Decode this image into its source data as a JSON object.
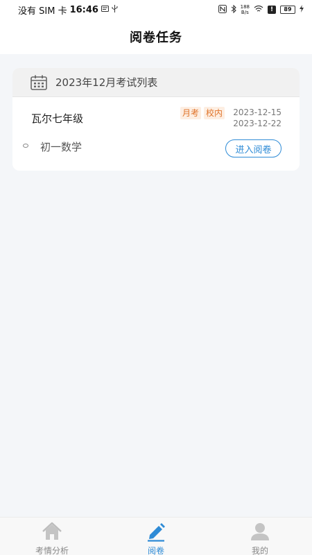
{
  "status_bar": {
    "carrier": "没有 SIM 卡",
    "time": "16:46",
    "net_speed_top": "188",
    "net_speed_bottom": "B/s",
    "alert": "!",
    "battery": "89"
  },
  "header": {
    "title": "阅卷任务"
  },
  "exam_list": {
    "heading": "2023年12月考试列表",
    "exams": [
      {
        "name": "瓦尔七年级",
        "tags": [
          "月考",
          "校内"
        ],
        "start_date": "2023-12-15",
        "end_date": "2023-12-22",
        "subjects": [
          {
            "name": "初一数学",
            "action_label": "进入阅卷"
          }
        ]
      }
    ]
  },
  "tabbar": {
    "tabs": [
      {
        "label": "考情分析",
        "icon": "home-icon",
        "active": false
      },
      {
        "label": "阅卷",
        "icon": "pen-icon",
        "active": true
      },
      {
        "label": "我的",
        "icon": "user-icon",
        "active": false
      }
    ]
  },
  "colors": {
    "accent": "#2e8bd6",
    "tag_text": "#e0742a",
    "tag_bg": "#fdeee2",
    "page_bg": "#f4f6f9"
  }
}
